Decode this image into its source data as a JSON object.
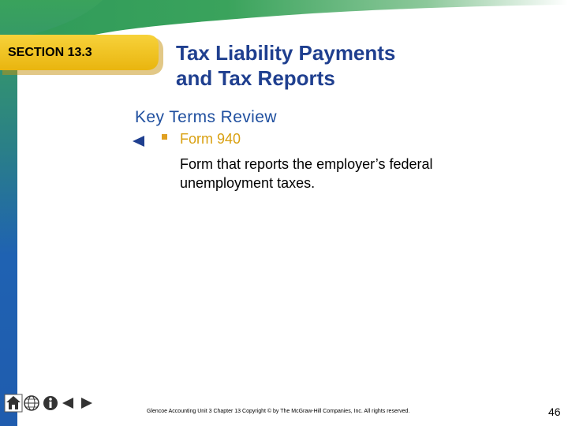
{
  "section": {
    "label": "SECTION 13.3"
  },
  "title": {
    "line1": "Tax Liability Payments",
    "line2": "and Tax Reports"
  },
  "subtitle": "Key Terms Review",
  "term": {
    "name": "Form 940",
    "definition_line1": "Form that reports the employer’s federal",
    "definition_line2": "unemployment taxes."
  },
  "footer": {
    "text": "Glencoe Accounting Unit 3 Chapter 13 Copyright © by The McGraw-Hill Companies, Inc. All rights reserved."
  },
  "page_number": "46",
  "nav": {
    "buttons": [
      "home-icon",
      "globe-icon",
      "info-icon",
      "previous-arrow-icon",
      "next-arrow-icon"
    ]
  },
  "colors": {
    "sidebar_blue": "#1f62b2",
    "sidebar_green": "#3a9f5a",
    "tab_yellow": "#f5c518",
    "title_blue": "#1f3f8f",
    "term_gold": "#d9a011"
  }
}
